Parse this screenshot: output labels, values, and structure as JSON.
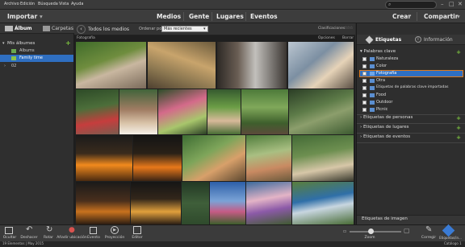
{
  "menu": {
    "items": [
      "Archivo",
      "Edición",
      "Búsqueda",
      "Vista",
      "Ayuda"
    ]
  },
  "topbar": {
    "import_label": "Importar",
    "tabs": [
      "Medios",
      "Gente",
      "Lugares",
      "Eventos"
    ],
    "create_label": "Crear",
    "share_label": "Compartir",
    "search_placeholder": ""
  },
  "left": {
    "album_tab": "Álbum",
    "folders_tab": "Carpetas",
    "my_albums": "Mis álbumes",
    "items": [
      "Albums",
      "Family time",
      "02"
    ]
  },
  "media_header": {
    "back_label": "Todos los medios",
    "sort_label": "Ordenar por:",
    "sort_value": "Más recientes",
    "ratings_label": "Clasificaciones",
    "filter_label": "Fotografía",
    "options_label": "Opciones",
    "clear_label": "Borrar"
  },
  "right": {
    "tabs": [
      "Etiquetas",
      "Información"
    ],
    "keywords_header": "Palabras clave",
    "keywords": [
      "Naturaleza",
      "Color",
      "Fotografía",
      "Otra",
      "Etiquetas de palabras clave importadas",
      "Food",
      "Outdoor",
      "Picnic"
    ],
    "people_tags": "Etiquetas de personas",
    "place_tags": "Etiquetas de lugares",
    "event_tags": "Etiquetas de eventos",
    "image_tags": "Etiquetas de imagen"
  },
  "bottom": {
    "buttons": [
      "Ocultar",
      "Deshacer",
      "Rotar",
      "Añadir ubicación",
      "Evento",
      "Proyección",
      "Editor"
    ],
    "zoom_label": "Zoom",
    "zoom_value": 0.42,
    "correct_label": "Corregir",
    "tags_label": "Etiquetas/in..."
  },
  "status": {
    "count": "19 Elementos  |  May 2015",
    "catalog": "Catálogo 1"
  },
  "colors": {
    "accent": "#3a7bd5",
    "selected": "#e07a1b",
    "green": "#7dc43f"
  }
}
